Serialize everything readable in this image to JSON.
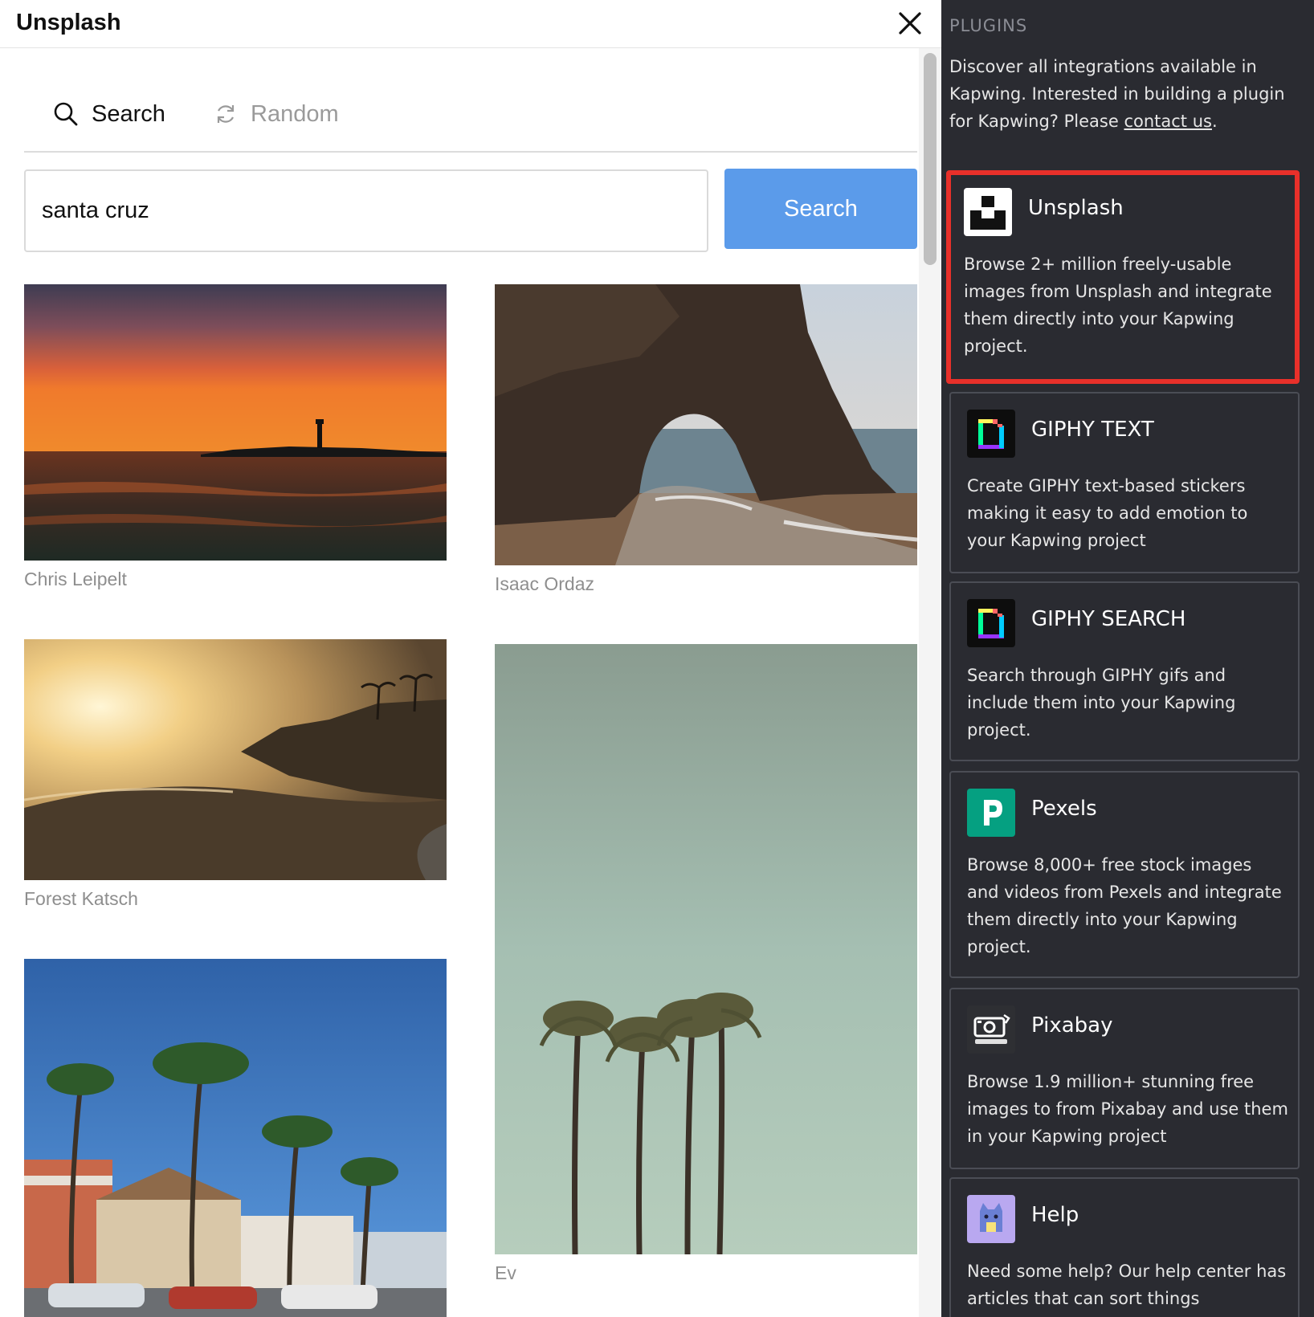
{
  "modal": {
    "title": "Unsplash",
    "tabs": [
      {
        "label": "Search",
        "icon": "search-icon",
        "active": true
      },
      {
        "label": "Random",
        "icon": "refresh-icon",
        "active": false
      }
    ],
    "search": {
      "value": "santa cruz",
      "button_label": "Search"
    },
    "photos": [
      {
        "caption": "Chris Leipelt"
      },
      {
        "caption": "Isaac Ordaz"
      },
      {
        "caption": "Forest Katsch"
      },
      {
        "caption": "Ev"
      },
      {
        "caption": ""
      }
    ]
  },
  "plugins": {
    "heading": "PLUGINS",
    "intro": "Discover all integrations available in Kapwing. Interested in building a plugin for Kapwing? Please ",
    "intro_link": "contact us",
    "intro_end": ".",
    "cards": [
      {
        "title": "Unsplash",
        "icon": "unsplash-icon",
        "highlighted": true,
        "description": "Browse 2+ million freely-usable images from Unsplash and integrate them directly into your Kapwing project."
      },
      {
        "title": "GIPHY TEXT",
        "icon": "giphy-icon",
        "description": "Create GIPHY text-based stickers making it easy to add emotion to your Kapwing project"
      },
      {
        "title": "GIPHY SEARCH",
        "icon": "giphy-icon",
        "description": "Search through GIPHY gifs and include them into your Kapwing project."
      },
      {
        "title": "Pexels",
        "icon": "pexels-icon",
        "description": "Browse 8,000+ free stock images and videos from Pexels and integrate them directly into your Kapwing project."
      },
      {
        "title": "Pixabay",
        "icon": "pixabay-icon",
        "description": "Browse 1.9 million+ stunning free images to from Pixabay and use them in your Kapwing project"
      },
      {
        "title": "Help",
        "icon": "help-cat-icon",
        "description": "Need some help? Our help center has articles that can sort things"
      }
    ]
  },
  "colors": {
    "accent": "#5b9bea",
    "highlight": "#e8302a",
    "panel_bg": "#2a2b31",
    "pexels": "#05a081"
  }
}
